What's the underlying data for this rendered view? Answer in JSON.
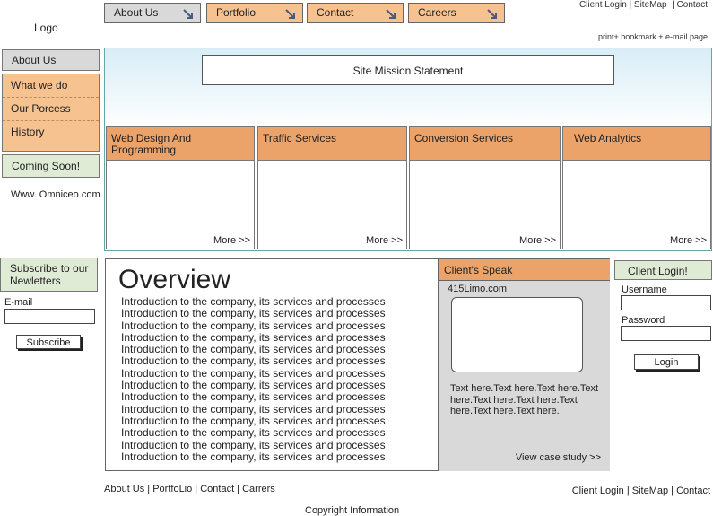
{
  "header": {
    "logo": "Logo",
    "top_links": "Client Login | SiteMap  | Contact",
    "print_links": "print+ bookmark + e-mail page"
  },
  "nav": [
    {
      "label": "About Us",
      "style": "gray"
    },
    {
      "label": "Portfolio",
      "style": "orange"
    },
    {
      "label": "Contact",
      "style": "orange"
    },
    {
      "label": "Careers",
      "style": "orange"
    }
  ],
  "sidebar": {
    "about": "About Us",
    "items": [
      "What we do",
      "Our Porcess",
      "History"
    ],
    "coming_soon": "Coming Soon!",
    "website": "Www. Omniceo.com"
  },
  "hero": {
    "mission": "Site Mission Statement"
  },
  "services": [
    {
      "title": "Web Design And Programming",
      "more": "More >>"
    },
    {
      "title": "Traffic Services",
      "more": "More >>"
    },
    {
      "title": "Conversion Services",
      "more": "More >>"
    },
    {
      "title": "Web Analytics",
      "more": "More >>"
    }
  ],
  "overview": {
    "title": "Overview",
    "line": "Introduction to the company, its services and processes",
    "line_count": 14
  },
  "clients_speak": {
    "title": "Client's Speak",
    "site": "415Limo.com",
    "text": "Text here.Text here.Text here.Text here.Text here.Text here.Text here.Text here.Text here.",
    "more": "View case study >>"
  },
  "subscribe": {
    "title": "Subscribe to our Newletters",
    "email_label": "E-mail",
    "button": "Subscribe"
  },
  "login": {
    "title": "Client Login!",
    "username_label": "Username",
    "password_label": "Password",
    "button": "Login"
  },
  "footer": {
    "left": "About Us | PortfoLio | Contact | Carrers",
    "right": "Client Login | SiteMap  | Contact",
    "copyright": "Copyright Information"
  }
}
